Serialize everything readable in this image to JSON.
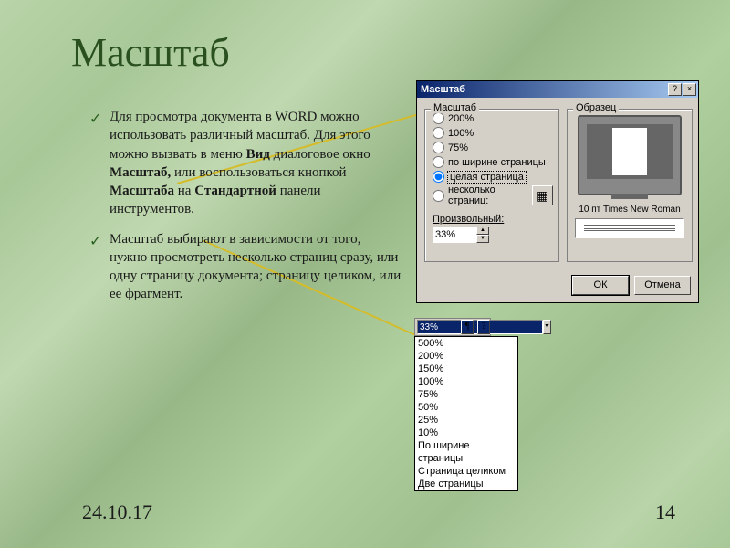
{
  "slide": {
    "title": "Масштаб",
    "bullet1_pre": "Для просмотра документа в WORD можно использовать различный масштаб. Для этого можно вызвать в меню ",
    "bullet1_b1": "Вид",
    "bullet1_mid1": " диалоговое окно ",
    "bullet1_b2": "Масштаб,",
    "bullet1_mid2": " или воспользоваться кнопкой ",
    "bullet1_b3": "Масштаба",
    "bullet1_mid3": " на ",
    "bullet1_b4": "Стандартной",
    "bullet1_post": " панели инструментов.",
    "bullet2": "Масштаб выбирают в зависимости от того, нужно просмотреть несколько страниц сразу, или одну страницу документа; страницу целиком, или ее фрагмент.",
    "date": "24.10.17",
    "page": "14"
  },
  "dialog": {
    "title": "Масштаб",
    "group_scale": "Масштаб",
    "group_sample": "Образец",
    "r200": "200%",
    "r100": "100%",
    "r75": "75%",
    "r_width": "по ширине страницы",
    "r_whole": "целая страница",
    "r_multi": "несколько страниц:",
    "arbitrary_label": "Произвольный:",
    "arbitrary_value": "33%",
    "sample_font": "10 пт Times New Roman",
    "ok": "ОК",
    "cancel": "Отмена"
  },
  "toolbar": {
    "combo_value": "33%",
    "help_icon": "?"
  },
  "dropdown": {
    "i0": "500%",
    "i1": "200%",
    "i2": "150%",
    "i3": "100%",
    "i4": "75%",
    "i5": "50%",
    "i6": "25%",
    "i7": "10%",
    "i8": "По ширине страницы",
    "i9": "Страница целиком",
    "i10": "Две страницы"
  }
}
